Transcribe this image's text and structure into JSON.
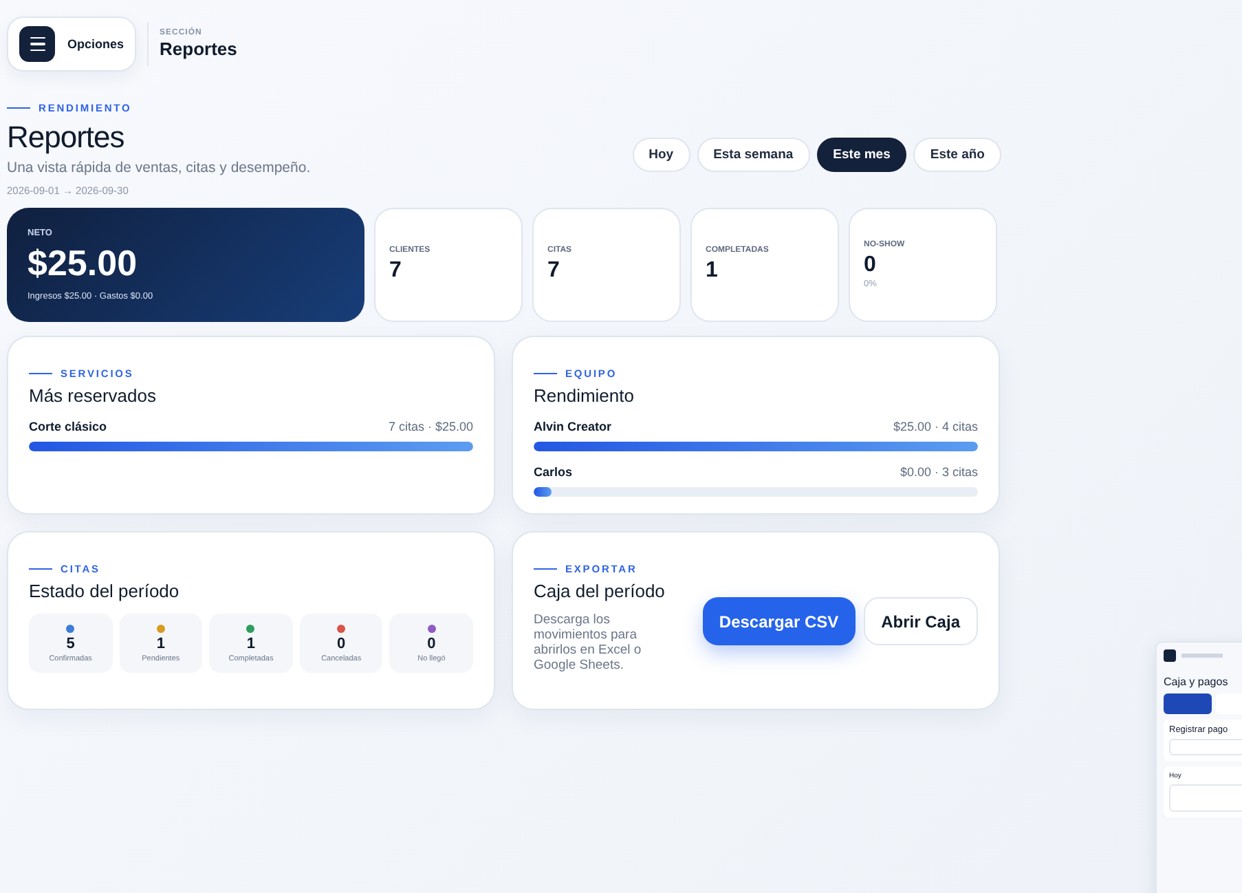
{
  "header": {
    "menu_label": "Opciones",
    "section_label": "SECCIÓN",
    "section_title": "Reportes"
  },
  "hero": {
    "eyebrow": "RENDIMIENTO",
    "title": "Reportes",
    "subtitle": "Una vista rápida de ventas, citas y desempeño.",
    "date_range": "2026-09-01 → 2026-09-30"
  },
  "periods": [
    {
      "label": "Hoy",
      "selected": false
    },
    {
      "label": "Esta semana",
      "selected": false
    },
    {
      "label": "Este mes",
      "selected": true
    },
    {
      "label": "Este año",
      "selected": false
    }
  ],
  "net": {
    "label": "NETO",
    "value": "$25.00",
    "detail": "Ingresos $25.00 · Gastos $0.00"
  },
  "stats": [
    {
      "label": "CLIENTES",
      "value": "7"
    },
    {
      "label": "CITAS",
      "value": "7"
    },
    {
      "label": "COMPLETADAS",
      "value": "1"
    },
    {
      "label": "NO-SHOW",
      "value": "0",
      "note": "0%"
    }
  ],
  "services": {
    "eyebrow": "SERVICIOS",
    "title": "Más reservados",
    "items": [
      {
        "name": "Corte clásico",
        "reading": "7 citas · $25.00",
        "level": 1
      }
    ]
  },
  "team": {
    "eyebrow": "EQUIPO",
    "title": "Rendimiento",
    "items": [
      {
        "name": "Alvin Creator",
        "reading": "$25.00 · 4 citas",
        "level": 1
      },
      {
        "name": "Carlos",
        "reading": "$0.00 · 3 citas",
        "level": 0.04
      }
    ]
  },
  "appointments": {
    "eyebrow": "CITAS",
    "title": "Estado del período",
    "statuses": [
      {
        "count": "5",
        "label": "Confirmadas",
        "color": "#3b7dd8"
      },
      {
        "count": "1",
        "label": "Pendientes",
        "color": "#d99a1e"
      },
      {
        "count": "1",
        "label": "Completadas",
        "color": "#2e9e5e"
      },
      {
        "count": "0",
        "label": "Canceladas",
        "color": "#d9544a"
      },
      {
        "count": "0",
        "label": "No llegó",
        "color": "#8e5cc4"
      }
    ]
  },
  "export": {
    "eyebrow": "EXPORTAR",
    "title": "Caja del período",
    "description": "Descarga los movimientos para abrirlos en Excel o Google Sheets.",
    "buttons": [
      {
        "label": "Descargar CSV",
        "kind": "primary"
      },
      {
        "label": "Abrir Caja",
        "kind": "secondary"
      }
    ]
  },
  "preview": {
    "title": "Caja y pagos",
    "section": "Registrar pago",
    "list_title": "Hoy"
  }
}
